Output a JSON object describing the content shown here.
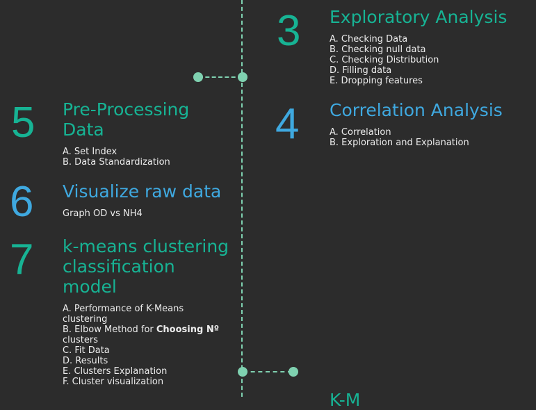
{
  "colors": {
    "background": "#2c2c2c",
    "green": "#17b394",
    "blue": "#3fa9e0",
    "timeline": "#7fd1b0",
    "text": "#ececec"
  },
  "sections": {
    "s3": {
      "number": "3",
      "title": "Exploratory Analysis",
      "items": [
        "A. Checking Data",
        "B. Checking null data",
        "C. Checking Distribution",
        "D. Filling data",
        "E. Dropping features"
      ]
    },
    "s4": {
      "number": "4",
      "title": "Correlation Analysis",
      "items": [
        "A. Correlation",
        "B. Exploration and Explanation"
      ]
    },
    "s5": {
      "number": "5",
      "title_line1": "Pre-Processing",
      "title_line2": "Data",
      "items": [
        "A. Set Index",
        "B. Data Standardization"
      ]
    },
    "s6": {
      "number": "6",
      "title": "Visualize raw data",
      "items": [
        "Graph OD vs NH4"
      ]
    },
    "s7": {
      "number": "7",
      "title_line1": "k-means clustering",
      "title_line2": "classification",
      "title_line3": "model",
      "items": {
        "a1": "A. Performance of K-Means",
        "a2": "clustering",
        "b1_prefix": "B. Elbow Method for ",
        "b1_bold": "Choosing Nº",
        "b2": "clusters",
        "c": "C. Fit Data",
        "d": "D. Results",
        "e": "E. Clusters Explanation",
        "f": "F. Cluster visualization"
      }
    },
    "s8": {
      "title_partial": "K-M"
    }
  }
}
